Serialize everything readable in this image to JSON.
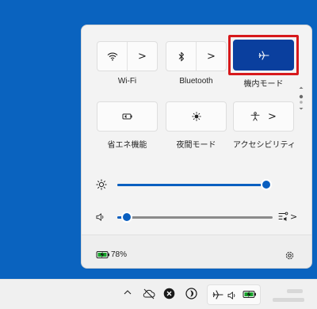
{
  "quick_settings": {
    "tiles_row1": [
      {
        "label": "Wi-Fi",
        "icon": "wifi-icon",
        "has_chevron": true,
        "active": false
      },
      {
        "label": "Bluetooth",
        "icon": "bluetooth-icon",
        "has_chevron": true,
        "active": false
      },
      {
        "label": "機内モード",
        "icon": "airplane-icon",
        "has_chevron": false,
        "active": true,
        "highlighted": true
      }
    ],
    "tiles_row2": [
      {
        "label": "省エネ機能",
        "icon": "battery-saver-icon",
        "has_chevron": false,
        "active": false
      },
      {
        "label": "夜間モード",
        "icon": "night-light-icon",
        "has_chevron": false,
        "active": false
      },
      {
        "label": "アクセシビリティ",
        "icon": "accessibility-icon",
        "has_chevron": true,
        "active": false
      }
    ],
    "chevron": ">",
    "brightness": {
      "icon": "brightness-icon",
      "level_percent": 100
    },
    "volume": {
      "icon": "speaker-icon",
      "level_percent": 6,
      "output_icon": "audio-output-icon",
      "chevron": ">"
    },
    "battery": {
      "percent_text": "78%",
      "icon": "battery-charging-icon"
    },
    "settings_icon": "gear-icon",
    "highlight_color": "#d7191c",
    "accent_color": "#0a3f9e"
  },
  "taskbar": {
    "tray_icons": [
      "chevron-up-icon",
      "cloud-off-icon",
      "close-circle-icon",
      "moon-app-icon"
    ],
    "group_icons": [
      "airplane-icon",
      "speaker-icon",
      "battery-charging-icon"
    ],
    "up_chevron": "^"
  }
}
